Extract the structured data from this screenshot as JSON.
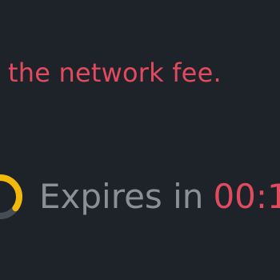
{
  "notice": {
    "text": "the network fee."
  },
  "expiry": {
    "label": "Expires in",
    "countdown": "00:1",
    "timer_icon": "countdown-ring-icon",
    "remaining_fraction": 0.35
  },
  "colors": {
    "background": "#1e2329",
    "alert_red": "#e24b5f",
    "muted_text": "#8b9097",
    "timer_yellow": "#f0b90b",
    "timer_track": "#474d57"
  }
}
